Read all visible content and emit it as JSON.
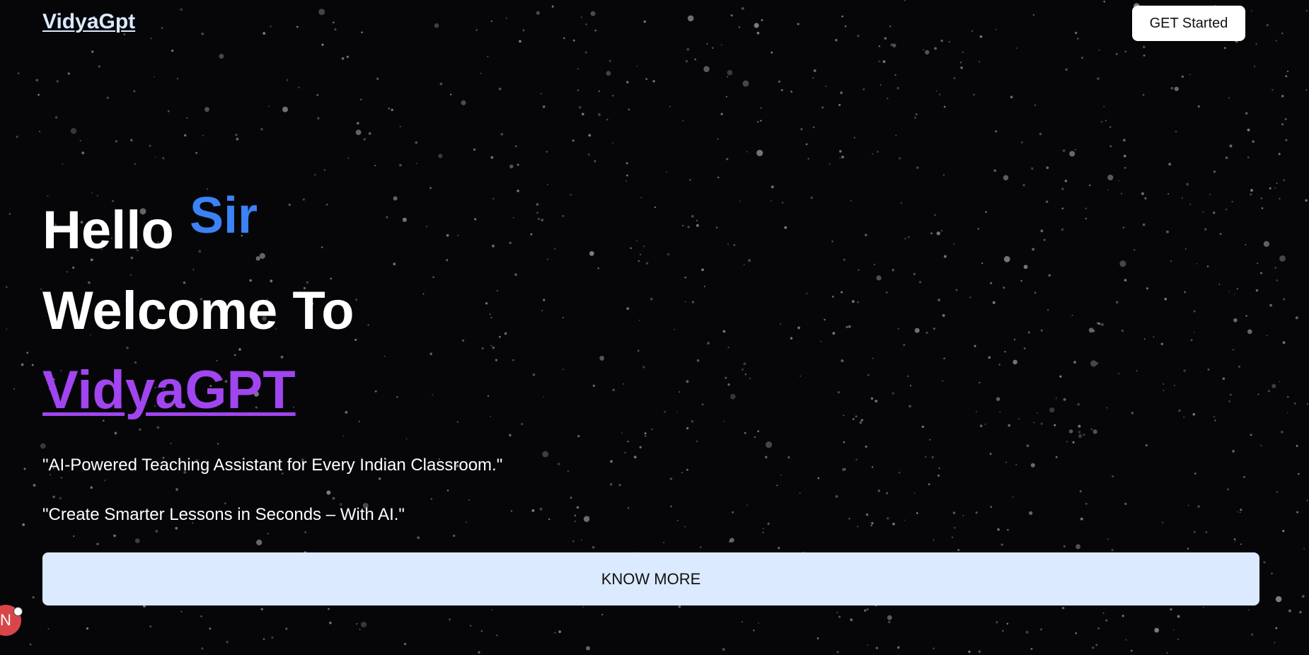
{
  "header": {
    "logo": "VidyaGpt",
    "cta_label": "GET Started"
  },
  "hero": {
    "greeting": "Hello",
    "honorific": "Sir",
    "welcome": "Welcome To",
    "brand": "VidyaGPT",
    "tagline_1": "\"AI-Powered Teaching Assistant for Every Indian Classroom.\"",
    "tagline_2": "\"Create Smarter Lessons in Seconds – With AI.\"",
    "know_more_label": "KNOW MORE"
  },
  "floating_badge": {
    "initial": "N"
  },
  "colors": {
    "background": "#060609",
    "honorific": "#3b82f6",
    "brand": "#a145f0",
    "know_more_bg": "#dbeafe",
    "badge": "#d9464a"
  }
}
